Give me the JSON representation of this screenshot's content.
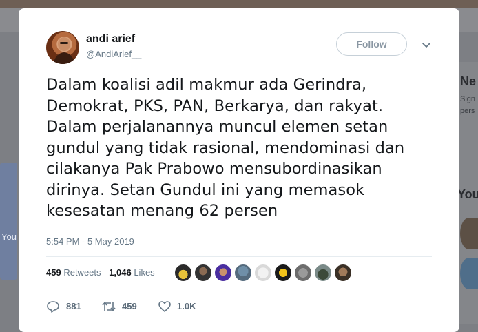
{
  "tweet": {
    "author_name": "andi arief",
    "author_handle": "@AndiArief__",
    "follow_label": "Follow",
    "text": "Dalam koalisi adil makmur ada Gerindra,\nDemokrat, PKS, PAN, Berkarya, dan rakyat.\nDalam perjalanannya  muncul elemen setan\ngundul yang tidak rasional, mendominasi dan\ncilakanya Pak Prabowo mensubordinasikan\ndirinya. Setan Gundul ini yang memasok\nkesesatan menang 62 persen",
    "timestamp": "5:54 PM - 5 May 2019",
    "retweets_count": "459",
    "retweets_label": "Retweets",
    "likes_count": "1,046",
    "likes_label": "Likes",
    "actions": {
      "reply_count": "881",
      "retweet_count": "459",
      "like_count": "1.0K"
    }
  },
  "background": {
    "left_card_label": "You",
    "right_heading_1": "Ne",
    "right_line_1": "Sign",
    "right_line_2": "pers",
    "right_heading_2": "You"
  },
  "colors": {
    "overlay": "#7d7f84",
    "text": "#14171a",
    "secondary": "#657786",
    "border": "#e6ecf0"
  }
}
